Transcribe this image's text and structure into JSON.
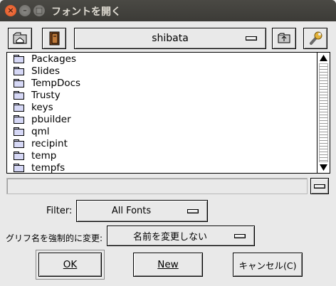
{
  "window": {
    "title": "フォントを開く",
    "close_glyph": "×",
    "min_glyph": "–",
    "max_glyph": "□"
  },
  "toolbar": {
    "icons": [
      "home-folder-icon",
      "bookmark-icon",
      "parent-folder-icon",
      "settings-icon"
    ],
    "directory": "shibata"
  },
  "files": [
    "Packages",
    "Slides",
    "TempDocs",
    "Trusty",
    "keys",
    "pbuilder",
    "qml",
    "recipint",
    "temp",
    "tempfs"
  ],
  "path_field": {
    "value": ""
  },
  "filter": {
    "label": "Filter:",
    "value": "All Fonts"
  },
  "rename": {
    "label": "グリフ名を強制的に変更:",
    "value": "名前を変更しない"
  },
  "buttons": {
    "ok": "OK",
    "new": "New",
    "cancel": "キャンセル(C)"
  },
  "colors": {
    "titlebar": "#3c3b37",
    "close": "#e0531a",
    "folder_fill": "#d6d8f6"
  }
}
